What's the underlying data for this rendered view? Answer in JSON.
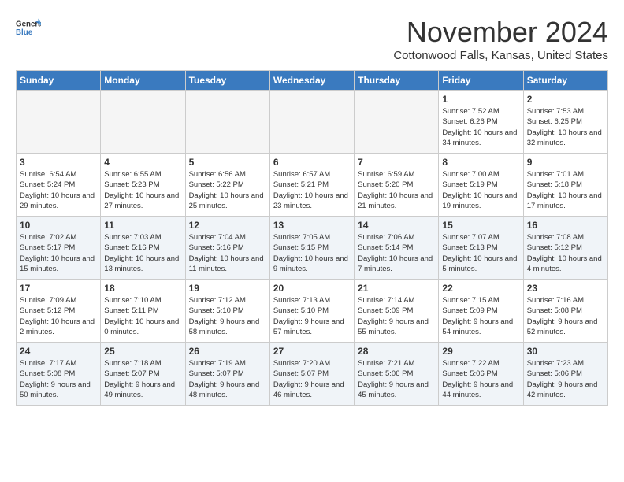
{
  "header": {
    "logo_line1": "General",
    "logo_line2": "Blue",
    "title": "November 2024",
    "subtitle": "Cottonwood Falls, Kansas, United States"
  },
  "weekdays": [
    "Sunday",
    "Monday",
    "Tuesday",
    "Wednesday",
    "Thursday",
    "Friday",
    "Saturday"
  ],
  "weeks": [
    [
      {
        "day": "",
        "info": ""
      },
      {
        "day": "",
        "info": ""
      },
      {
        "day": "",
        "info": ""
      },
      {
        "day": "",
        "info": ""
      },
      {
        "day": "",
        "info": ""
      },
      {
        "day": "1",
        "info": "Sunrise: 7:52 AM\nSunset: 6:26 PM\nDaylight: 10 hours\nand 34 minutes."
      },
      {
        "day": "2",
        "info": "Sunrise: 7:53 AM\nSunset: 6:25 PM\nDaylight: 10 hours\nand 32 minutes."
      }
    ],
    [
      {
        "day": "3",
        "info": "Sunrise: 6:54 AM\nSunset: 5:24 PM\nDaylight: 10 hours\nand 29 minutes."
      },
      {
        "day": "4",
        "info": "Sunrise: 6:55 AM\nSunset: 5:23 PM\nDaylight: 10 hours\nand 27 minutes."
      },
      {
        "day": "5",
        "info": "Sunrise: 6:56 AM\nSunset: 5:22 PM\nDaylight: 10 hours\nand 25 minutes."
      },
      {
        "day": "6",
        "info": "Sunrise: 6:57 AM\nSunset: 5:21 PM\nDaylight: 10 hours\nand 23 minutes."
      },
      {
        "day": "7",
        "info": "Sunrise: 6:59 AM\nSunset: 5:20 PM\nDaylight: 10 hours\nand 21 minutes."
      },
      {
        "day": "8",
        "info": "Sunrise: 7:00 AM\nSunset: 5:19 PM\nDaylight: 10 hours\nand 19 minutes."
      },
      {
        "day": "9",
        "info": "Sunrise: 7:01 AM\nSunset: 5:18 PM\nDaylight: 10 hours\nand 17 minutes."
      }
    ],
    [
      {
        "day": "10",
        "info": "Sunrise: 7:02 AM\nSunset: 5:17 PM\nDaylight: 10 hours\nand 15 minutes."
      },
      {
        "day": "11",
        "info": "Sunrise: 7:03 AM\nSunset: 5:16 PM\nDaylight: 10 hours\nand 13 minutes."
      },
      {
        "day": "12",
        "info": "Sunrise: 7:04 AM\nSunset: 5:16 PM\nDaylight: 10 hours\nand 11 minutes."
      },
      {
        "day": "13",
        "info": "Sunrise: 7:05 AM\nSunset: 5:15 PM\nDaylight: 10 hours\nand 9 minutes."
      },
      {
        "day": "14",
        "info": "Sunrise: 7:06 AM\nSunset: 5:14 PM\nDaylight: 10 hours\nand 7 minutes."
      },
      {
        "day": "15",
        "info": "Sunrise: 7:07 AM\nSunset: 5:13 PM\nDaylight: 10 hours\nand 5 minutes."
      },
      {
        "day": "16",
        "info": "Sunrise: 7:08 AM\nSunset: 5:12 PM\nDaylight: 10 hours\nand 4 minutes."
      }
    ],
    [
      {
        "day": "17",
        "info": "Sunrise: 7:09 AM\nSunset: 5:12 PM\nDaylight: 10 hours\nand 2 minutes."
      },
      {
        "day": "18",
        "info": "Sunrise: 7:10 AM\nSunset: 5:11 PM\nDaylight: 10 hours\nand 0 minutes."
      },
      {
        "day": "19",
        "info": "Sunrise: 7:12 AM\nSunset: 5:10 PM\nDaylight: 9 hours\nand 58 minutes."
      },
      {
        "day": "20",
        "info": "Sunrise: 7:13 AM\nSunset: 5:10 PM\nDaylight: 9 hours\nand 57 minutes."
      },
      {
        "day": "21",
        "info": "Sunrise: 7:14 AM\nSunset: 5:09 PM\nDaylight: 9 hours\nand 55 minutes."
      },
      {
        "day": "22",
        "info": "Sunrise: 7:15 AM\nSunset: 5:09 PM\nDaylight: 9 hours\nand 54 minutes."
      },
      {
        "day": "23",
        "info": "Sunrise: 7:16 AM\nSunset: 5:08 PM\nDaylight: 9 hours\nand 52 minutes."
      }
    ],
    [
      {
        "day": "24",
        "info": "Sunrise: 7:17 AM\nSunset: 5:08 PM\nDaylight: 9 hours\nand 50 minutes."
      },
      {
        "day": "25",
        "info": "Sunrise: 7:18 AM\nSunset: 5:07 PM\nDaylight: 9 hours\nand 49 minutes."
      },
      {
        "day": "26",
        "info": "Sunrise: 7:19 AM\nSunset: 5:07 PM\nDaylight: 9 hours\nand 48 minutes."
      },
      {
        "day": "27",
        "info": "Sunrise: 7:20 AM\nSunset: 5:07 PM\nDaylight: 9 hours\nand 46 minutes."
      },
      {
        "day": "28",
        "info": "Sunrise: 7:21 AM\nSunset: 5:06 PM\nDaylight: 9 hours\nand 45 minutes."
      },
      {
        "day": "29",
        "info": "Sunrise: 7:22 AM\nSunset: 5:06 PM\nDaylight: 9 hours\nand 44 minutes."
      },
      {
        "day": "30",
        "info": "Sunrise: 7:23 AM\nSunset: 5:06 PM\nDaylight: 9 hours\nand 42 minutes."
      }
    ]
  ]
}
